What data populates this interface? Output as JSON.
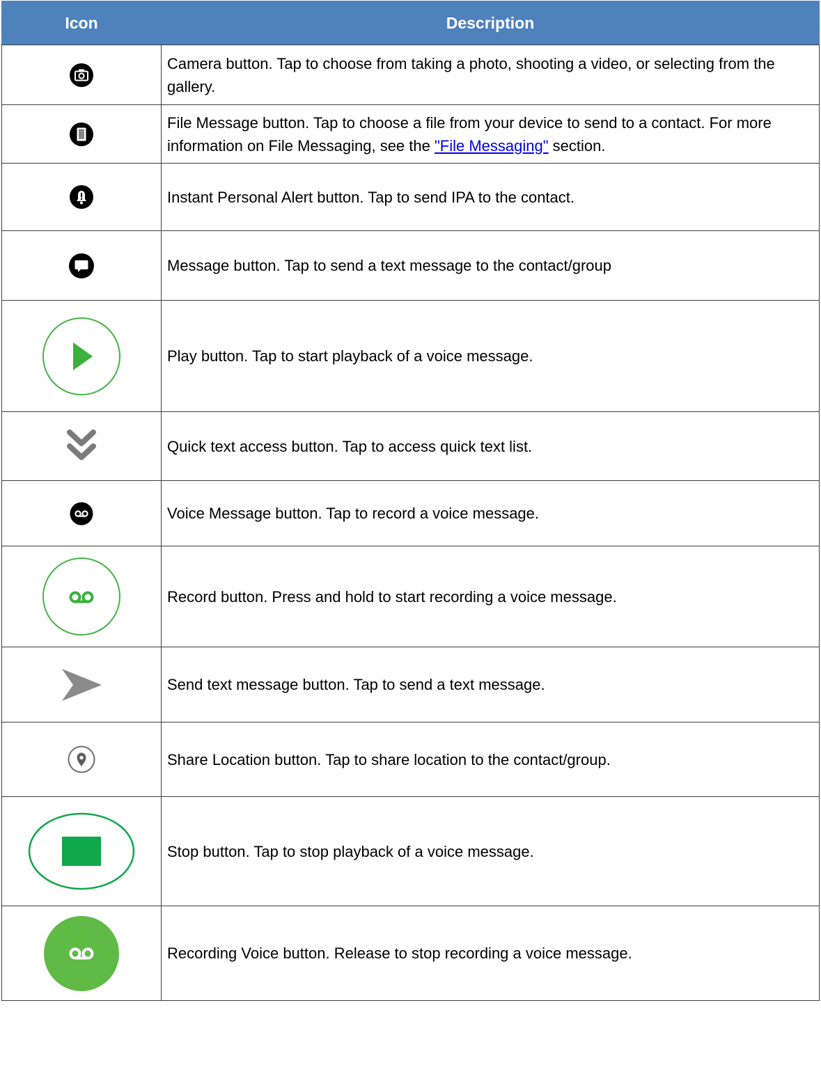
{
  "table": {
    "headers": {
      "icon": "Icon",
      "description": "Description"
    },
    "rows": [
      {
        "icon": "camera-icon",
        "text": "Camera button. Tap to choose from taking a photo, shooting a video, or selecting from the gallery."
      },
      {
        "icon": "file-message-icon",
        "text_before": "File Message button. Tap to choose a file from your device to send to a contact. For more information on File Messaging, see the ",
        "link": "\"File Messaging\"",
        "text_after": " section."
      },
      {
        "icon": "alert-bell-icon",
        "text": "Instant Personal Alert button. Tap to send IPA to the contact."
      },
      {
        "icon": "message-bubble-icon",
        "text": "Message button. Tap to send a text message to the contact/group"
      },
      {
        "icon": "play-icon",
        "text": "Play button. Tap to start playback of a voice message."
      },
      {
        "icon": "double-chevron-down-icon",
        "text": "Quick text access button. Tap to access quick text list."
      },
      {
        "icon": "voicemail-icon",
        "text": "Voice Message button. Tap to record a voice message."
      },
      {
        "icon": "record-icon",
        "text": "Record button. Press and hold to start recording a voice message."
      },
      {
        "icon": "send-arrow-icon",
        "text": "Send text message button. Tap to send a text message."
      },
      {
        "icon": "location-pin-icon",
        "text": "Share Location button. Tap to share location to the contact/group."
      },
      {
        "icon": "stop-icon",
        "text": "Stop button. Tap to stop playback of a voice message."
      },
      {
        "icon": "recording-voice-icon",
        "text": "Recording Voice button. Release to stop recording a voice message."
      }
    ]
  },
  "colors": {
    "header_bg": "#4f81bd",
    "header_text": "#ffffff",
    "green": "#3cb13c",
    "dark_green": "#0fa84a",
    "gray": "#8a8a8a",
    "link": "#0000ee"
  }
}
